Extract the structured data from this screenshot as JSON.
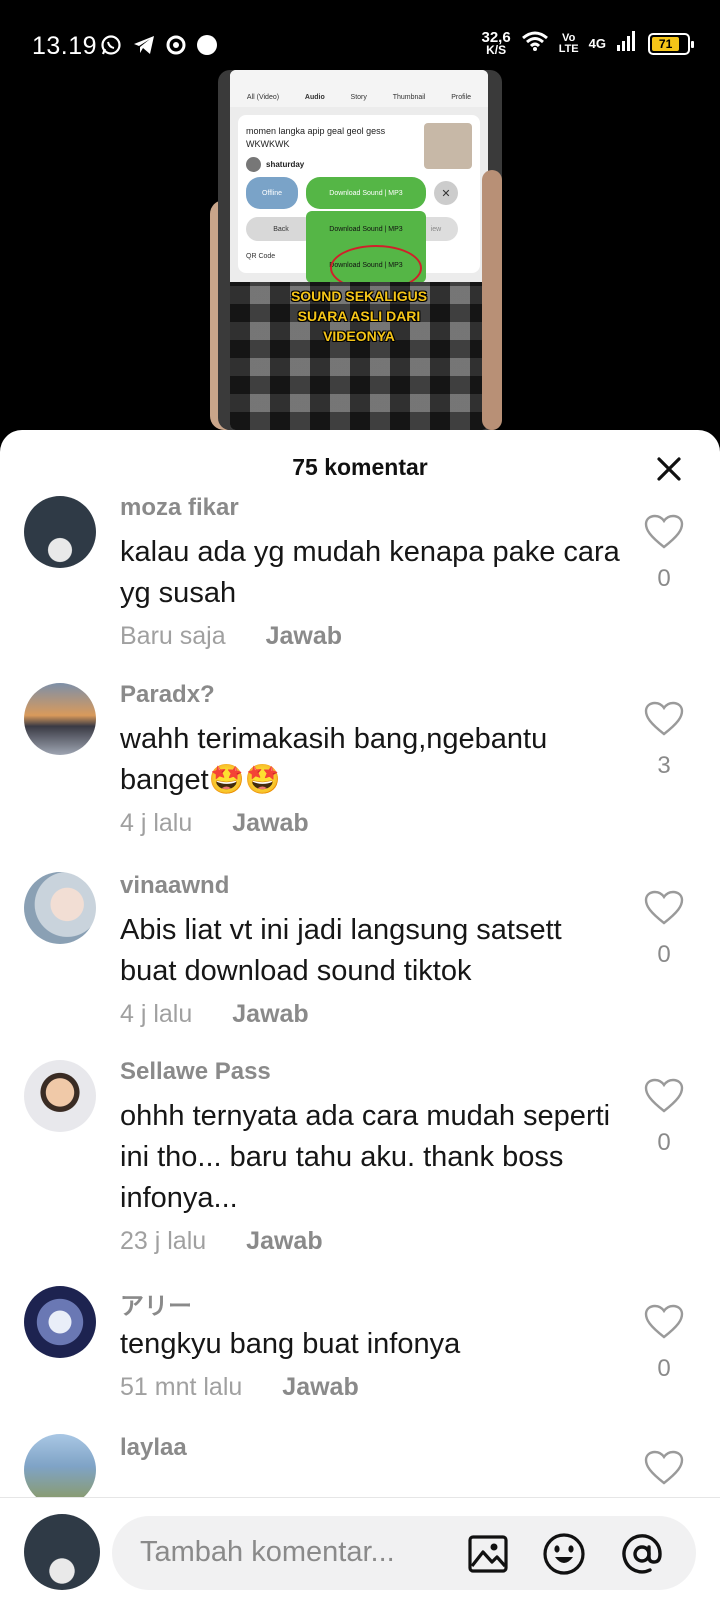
{
  "status_bar": {
    "time": "13.19",
    "speed_value": "32,6",
    "speed_unit": "K/S",
    "volte_top": "Vo",
    "volte_bottom": "LTE",
    "network": "4G",
    "battery": "71"
  },
  "video": {
    "tabs": [
      "All (Video)",
      "Audio",
      "Story",
      "Thumbnail",
      "Profile"
    ],
    "card_title": "momen langka apip geal geol gess WKWKWK",
    "card_author": "shaturday",
    "offline_label": "Offline",
    "download_label": "Download Sound | MP3",
    "download_sub": "(Music)",
    "back_label": "Back",
    "ghost_label": "iew",
    "menu_item_1": "Download Sound | MP3",
    "menu_item_1_sub": "(Music)",
    "menu_item_2": "Download Sound | MP3",
    "menu_item_2_sub": "(Music and Audio)",
    "qr_label": "QR Code",
    "share_label": "are",
    "caption_lines": [
      "SOUND SEKALIGUS",
      "SUARA ASLI DARI",
      "VIDEONYA"
    ]
  },
  "sheet": {
    "title": "75 komentar"
  },
  "comments": [
    {
      "name": "moza fikar",
      "text": "kalau ada yg mudah kenapa pake cara yg susah",
      "time": "Baru saja",
      "reply": "Jawab",
      "likes": "0"
    },
    {
      "name": "Paradx?",
      "text": "wahh terimakasih bang,ngebantu banget🤩🤩",
      "time": "4 j lalu",
      "reply": "Jawab",
      "likes": "3"
    },
    {
      "name": "vinaawnd",
      "text": "Abis liat vt ini jadi langsung satsett buat download sound tiktok",
      "time": "4 j lalu",
      "reply": "Jawab",
      "likes": "0"
    },
    {
      "name": "Sellawe Pass",
      "text": "ohhh ternyata ada cara mudah seperti ini tho... baru tahu aku. thank boss infonya...",
      "time": "23 j lalu",
      "reply": "Jawab",
      "likes": "0"
    },
    {
      "name": "アリー",
      "text": "tengkyu bang buat infonya",
      "time": "51 mnt lalu",
      "reply": "Jawab",
      "likes": "0"
    },
    {
      "name": "laylaa",
      "text": "",
      "time": "",
      "reply": "",
      "likes": ""
    }
  ],
  "footer": {
    "placeholder": "Tambah komentar..."
  }
}
